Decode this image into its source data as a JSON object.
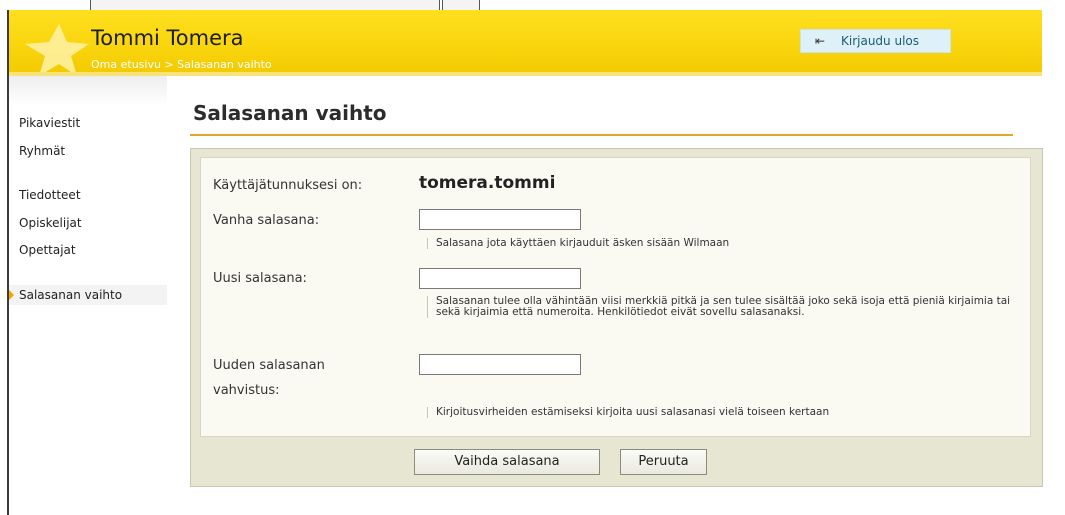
{
  "header": {
    "user_name": "Tommi Tomera",
    "breadcrumb": {
      "home": "Oma etusivu",
      "separator": " > ",
      "current": "Salasanan vaihto"
    },
    "logout": {
      "icon": "logout-icon",
      "label": "Kirjaudu ulos"
    },
    "colors": {
      "header_bg": "#f8d40c",
      "accent": "#e3a52a",
      "logout_bg": "#dff1f8"
    }
  },
  "sidebar": {
    "items": [
      {
        "label": "Pikaviestit"
      },
      {
        "label": "Ryhmät"
      },
      {
        "label": "Tiedotteet"
      },
      {
        "label": "Opiskelijat"
      },
      {
        "label": "Opettajat"
      },
      {
        "label": "Salasanan vaihto",
        "active": true
      }
    ]
  },
  "main": {
    "title": "Salasanan vaihto",
    "form": {
      "username_label": "Käyttäjätunnuksesi on:",
      "username_value": "tomera.tommi",
      "old_password": {
        "label": "Vanha salasana:",
        "value": "",
        "hint": "Salasana jota käyttäen kirjauduit äsken sisään Wilmaan"
      },
      "new_password": {
        "label": "Uusi salasana:",
        "value": "",
        "hint": "Salasanan tulee olla vähintään viisi merkkiä pitkä ja sen tulee sisältää joko sekä isoja että pieniä kirjaimia tai sekä kirjaimia että numeroita. Henkilötiedot eivät sovellu salasanaksi."
      },
      "confirm_password": {
        "label_line1": "Uuden salasanan",
        "label_line2": "vahvistus:",
        "value": "",
        "hint": "Kirjoitusvirheiden estämiseksi kirjoita uusi salasanasi vielä toiseen kertaan"
      }
    },
    "buttons": {
      "submit": "Vaihda salasana",
      "cancel": "Peruuta"
    }
  }
}
